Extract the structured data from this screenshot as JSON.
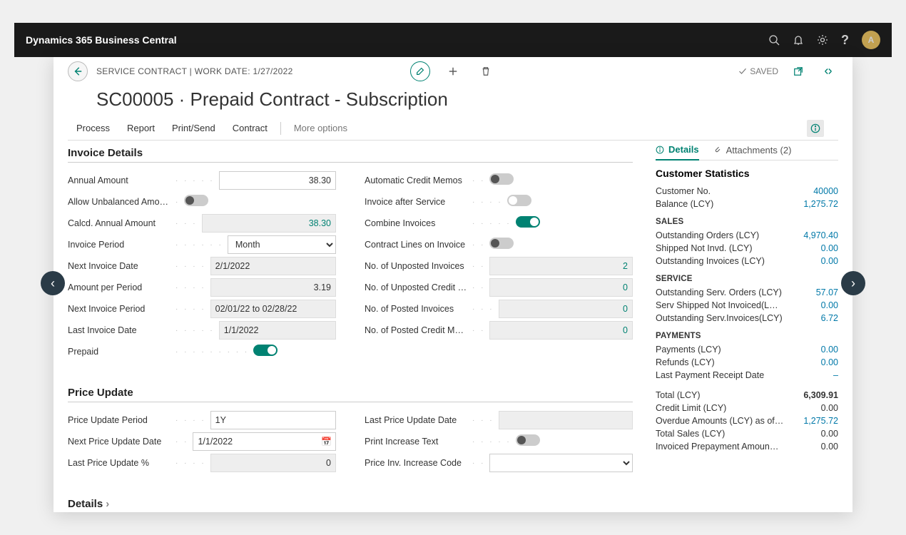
{
  "app": {
    "title": "Dynamics 365 Business Central",
    "avatar": "A"
  },
  "header": {
    "breadcrumb": "SERVICE CONTRACT | WORK DATE: 1/27/2022",
    "title": "SC00005 · Prepaid Contract - Subscription",
    "saved": "SAVED"
  },
  "actions": {
    "process": "Process",
    "report": "Report",
    "printSend": "Print/Send",
    "contract": "Contract",
    "more": "More options"
  },
  "sections": {
    "invoiceDetails": "Invoice Details",
    "priceUpdate": "Price Update",
    "details": "Details"
  },
  "invoice": {
    "left": {
      "annualAmount": {
        "label": "Annual Amount",
        "value": "38.30"
      },
      "allowUnbalanced": {
        "label": "Allow Unbalanced Amou…",
        "on": false
      },
      "calcdAnnual": {
        "label": "Calcd. Annual Amount",
        "value": "38.30"
      },
      "invoicePeriod": {
        "label": "Invoice Period",
        "value": "Month"
      },
      "nextInvoiceDate": {
        "label": "Next Invoice Date",
        "value": "2/1/2022"
      },
      "amountPerPeriod": {
        "label": "Amount per Period",
        "value": "3.19"
      },
      "nextInvoicePeriod": {
        "label": "Next Invoice Period",
        "value": "02/01/22 to 02/28/22"
      },
      "lastInvoiceDate": {
        "label": "Last Invoice Date",
        "value": "1/1/2022"
      },
      "prepaid": {
        "label": "Prepaid",
        "on": true
      }
    },
    "right": {
      "autoCreditMemos": {
        "label": "Automatic Credit Memos",
        "on": false
      },
      "invoiceAfterService": {
        "label": "Invoice after Service",
        "on": false
      },
      "combineInvoices": {
        "label": "Combine Invoices",
        "on": true
      },
      "contractLines": {
        "label": "Contract Lines on Invoice",
        "on": false
      },
      "unpostedInvoices": {
        "label": "No. of Unposted Invoices",
        "value": "2"
      },
      "unpostedCredit": {
        "label": "No. of Unposted Credit …",
        "value": "0"
      },
      "postedInvoices": {
        "label": "No. of Posted Invoices",
        "value": "0"
      },
      "postedCredit": {
        "label": "No. of Posted Credit Me…",
        "value": "0"
      }
    }
  },
  "priceUpdate": {
    "left": {
      "period": {
        "label": "Price Update Period",
        "value": "1Y"
      },
      "nextDate": {
        "label": "Next Price Update Date",
        "value": "1/1/2022"
      },
      "lastPct": {
        "label": "Last Price Update %",
        "value": "0"
      }
    },
    "right": {
      "lastDate": {
        "label": "Last Price Update Date",
        "value": ""
      },
      "printIncrease": {
        "label": "Print Increase Text",
        "on": false
      },
      "increaseCode": {
        "label": "Price Inv. Increase Code",
        "value": ""
      }
    }
  },
  "sideTabs": {
    "details": "Details",
    "attachments": "Attachments (2)"
  },
  "stats": {
    "heading": "Customer Statistics",
    "customerNo": {
      "label": "Customer No.",
      "value": "40000"
    },
    "balance": {
      "label": "Balance (LCY)",
      "value": "1,275.72"
    },
    "sales": {
      "heading": "SALES",
      "outstandingOrders": {
        "label": "Outstanding Orders (LCY)",
        "value": "4,970.40"
      },
      "shippedNotInvd": {
        "label": "Shipped Not Invd. (LCY)",
        "value": "0.00"
      },
      "outstandingInvoices": {
        "label": "Outstanding Invoices (LCY)",
        "value": "0.00"
      }
    },
    "service": {
      "heading": "SERVICE",
      "outstandingServOrders": {
        "label": "Outstanding Serv. Orders (LCY)",
        "value": "57.07"
      },
      "servShippedNotInv": {
        "label": "Serv Shipped Not Invoiced(L…",
        "value": "0.00"
      },
      "outstandingServInv": {
        "label": "Outstanding Serv.Invoices(LCY)",
        "value": "6.72"
      }
    },
    "payments": {
      "heading": "PAYMENTS",
      "payments": {
        "label": "Payments (LCY)",
        "value": "0.00"
      },
      "refunds": {
        "label": "Refunds (LCY)",
        "value": "0.00"
      },
      "lastReceipt": {
        "label": "Last Payment Receipt Date",
        "value": "–"
      }
    },
    "total": {
      "label": "Total (LCY)",
      "value": "6,309.91"
    },
    "creditLimit": {
      "label": "Credit Limit (LCY)",
      "value": "0.00"
    },
    "overdue": {
      "label": "Overdue Amounts (LCY) as of…",
      "value": "1,275.72"
    },
    "totalSales": {
      "label": "Total Sales (LCY)",
      "value": "0.00"
    },
    "invoicedPrepay": {
      "label": "Invoiced Prepayment Amoun…",
      "value": "0.00"
    }
  }
}
